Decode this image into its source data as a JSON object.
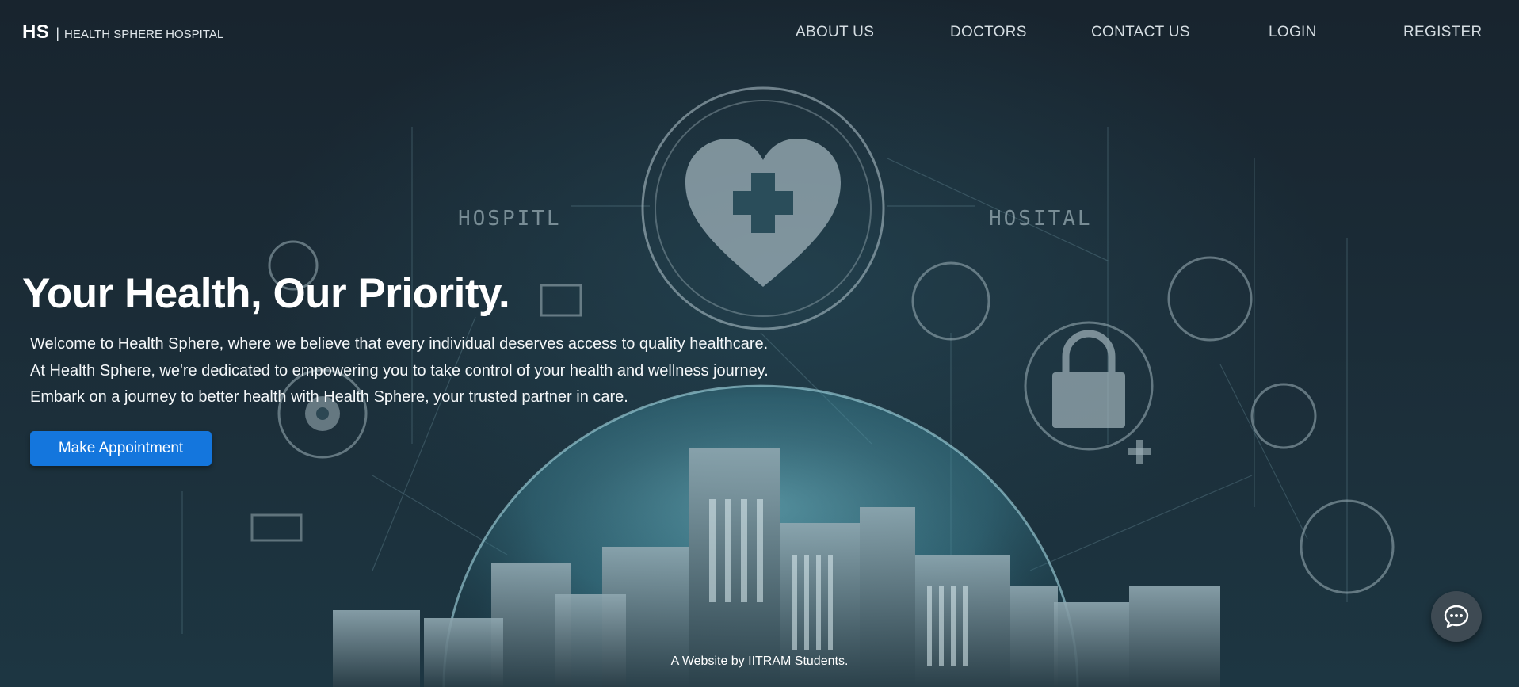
{
  "navbar": {
    "brand_abbr": "HS",
    "brand_separator": "|",
    "brand_name": "HEALTH SPHERE HOSPITAL",
    "links": {
      "about": "ABOUT US",
      "doctors": "DOCTORS",
      "contact": "CONTACT US",
      "login": "LOGIN",
      "register": "REGISTER"
    }
  },
  "hero": {
    "title": "Your Health, Our Priority.",
    "lines": [
      "Welcome to Health Sphere, where we believe that every individual deserves access to quality healthcare.",
      "At Health Sphere, we're dedicated to empowering you to take control of your health and wellness journey.",
      "Embark on a journey to better health with Health Sphere, your trusted partner in care."
    ],
    "button_label": "Make Appointment"
  },
  "background": {
    "sign_left": "HOSPITL",
    "sign_right": "HOSITAL"
  },
  "footer": {
    "credit": "A Website by IITRAM Students."
  },
  "chat": {
    "icon": "chat-bubble-icon"
  },
  "colors": {
    "primary_button": "#1476dd",
    "background": "#17232d",
    "accent_glow": "#4fa3b5"
  }
}
